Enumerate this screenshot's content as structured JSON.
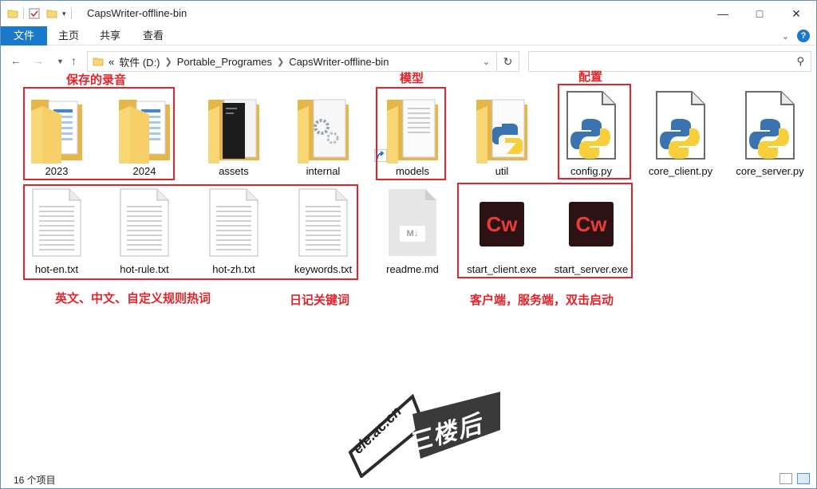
{
  "title_bar": {
    "title": "CapsWriter-offline-bin"
  },
  "ribbon": {
    "tabs": [
      "文件",
      "主页",
      "共享",
      "查看"
    ]
  },
  "address": {
    "prefix": "«",
    "crumbs": [
      "软件 (D:)",
      "Portable_Programes",
      "CapsWriter-offline-bin"
    ]
  },
  "search": {
    "placeholder": ""
  },
  "items": [
    {
      "name": "2023",
      "type": "folder-docs"
    },
    {
      "name": "2024",
      "type": "folder-docs"
    },
    {
      "name": "assets",
      "type": "folder-dark"
    },
    {
      "name": "internal",
      "type": "folder-gear"
    },
    {
      "name": "models",
      "type": "folder-shortcut"
    },
    {
      "name": "util",
      "type": "folder-python"
    },
    {
      "name": "config.py",
      "type": "python"
    },
    {
      "name": "core_client.py",
      "type": "python"
    },
    {
      "name": "core_server.py",
      "type": "python"
    },
    {
      "name": "hot-en.txt",
      "type": "text"
    },
    {
      "name": "hot-rule.txt",
      "type": "text"
    },
    {
      "name": "hot-zh.txt",
      "type": "text"
    },
    {
      "name": "keywords.txt",
      "type": "text"
    },
    {
      "name": "readme.md",
      "type": "markdown"
    },
    {
      "name": "start_client.exe",
      "type": "exe"
    },
    {
      "name": "start_server.exe",
      "type": "exe"
    }
  ],
  "annotations": {
    "recordings": "保存的录音",
    "models": "模型",
    "config": "配置",
    "hotwords": "英文、中文、自定义规则热词",
    "diary_keywords": "日记关键词",
    "client_server": "客户端，服务端，双击启动"
  },
  "exe_icon_text": "Cw",
  "md_icon_text": "M↓",
  "watermark": {
    "site": "ele.ac.cn",
    "name": "三楼后座"
  },
  "status": {
    "count": "16 个项目"
  },
  "colors": {
    "accent": "#1979ca",
    "annotation": "#e0252b",
    "folder": "#f8d775",
    "exe_bg": "#2c1214",
    "exe_text": "#e83b3b"
  }
}
